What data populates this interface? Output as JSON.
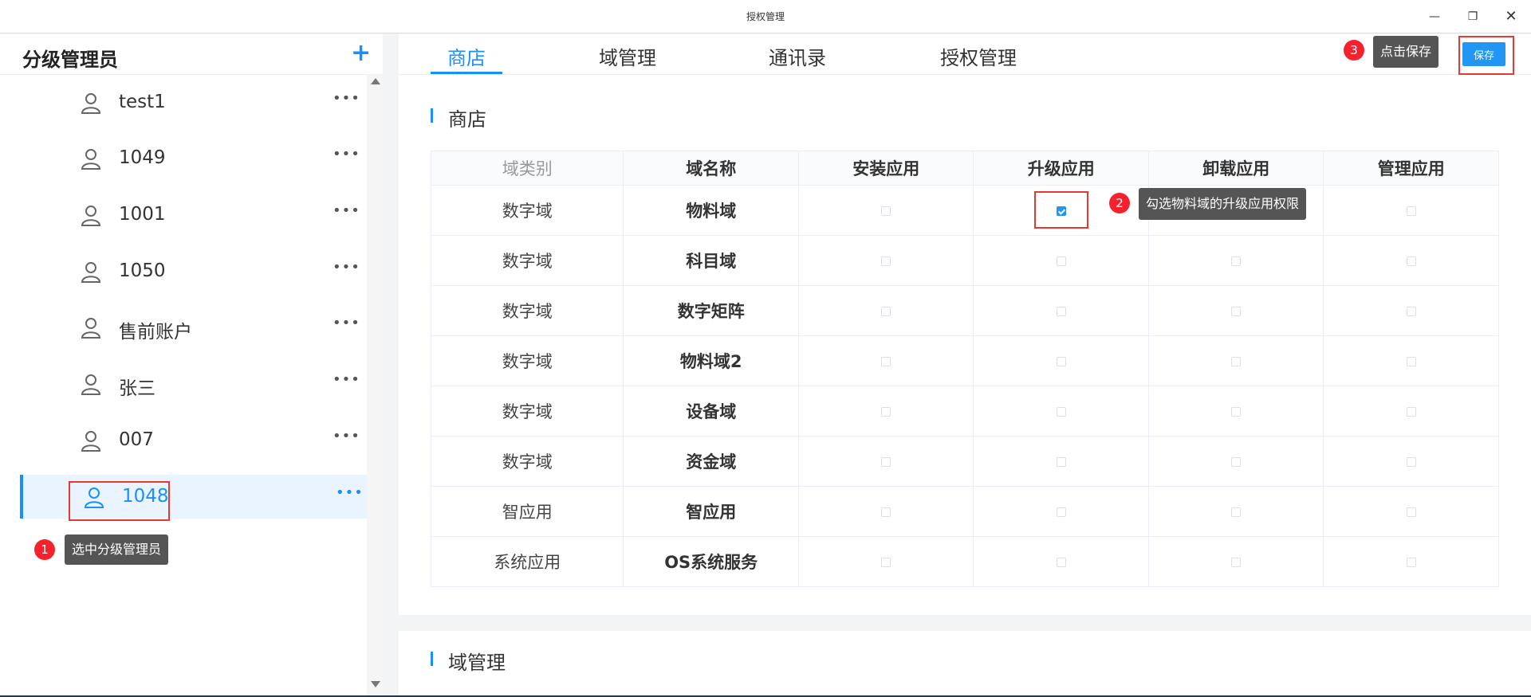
{
  "window": {
    "title": "授权管理",
    "min_glyph": "—",
    "max_glyph": "❐",
    "close_glyph": "✕"
  },
  "sidebar": {
    "title": "分级管理员",
    "add_glyph": "+",
    "more_glyph": "•••",
    "items": [
      {
        "label": "test1"
      },
      {
        "label": "1049"
      },
      {
        "label": "1001"
      },
      {
        "label": "1050"
      },
      {
        "label": "售前账户"
      },
      {
        "label": "张三"
      },
      {
        "label": "007"
      },
      {
        "label": "1048",
        "selected": true
      }
    ]
  },
  "tabs": [
    {
      "label": "商店",
      "active": true
    },
    {
      "label": "域管理"
    },
    {
      "label": "通讯录"
    },
    {
      "label": "授权管理"
    }
  ],
  "toolbar": {
    "save_label": "保存"
  },
  "sections": {
    "store": {
      "title": "商店",
      "columns": [
        "域类别",
        "域名称",
        "安装应用",
        "升级应用",
        "卸载应用",
        "管理应用"
      ],
      "rows": [
        {
          "category": "数字域",
          "name": "物料域",
          "install": false,
          "upgrade": true,
          "uninstall": false,
          "manage": false
        },
        {
          "category": "数字域",
          "name": "科目域",
          "install": false,
          "upgrade": false,
          "uninstall": false,
          "manage": false
        },
        {
          "category": "数字域",
          "name": "数字矩阵",
          "install": false,
          "upgrade": false,
          "uninstall": false,
          "manage": false
        },
        {
          "category": "数字域",
          "name": "物料域2",
          "install": false,
          "upgrade": false,
          "uninstall": false,
          "manage": false
        },
        {
          "category": "数字域",
          "name": "设备域",
          "install": false,
          "upgrade": false,
          "uninstall": false,
          "manage": false
        },
        {
          "category": "数字域",
          "name": "资金域",
          "install": false,
          "upgrade": false,
          "uninstall": false,
          "manage": false
        },
        {
          "category": "智应用",
          "name": "智应用",
          "install": false,
          "upgrade": false,
          "uninstall": false,
          "manage": false
        },
        {
          "category": "系统应用",
          "name": "OS系统服务",
          "install": false,
          "upgrade": false,
          "uninstall": false,
          "manage": false
        }
      ]
    },
    "domain": {
      "title": "域管理"
    }
  },
  "annotations": [
    {
      "step": "1",
      "text": "选中分级管理员"
    },
    {
      "step": "2",
      "text": "勾选物料域的升级应用权限"
    },
    {
      "step": "3",
      "text": "点击保存"
    }
  ],
  "colors": {
    "accent": "#1890ff",
    "highlight": "#e53935",
    "badge": "#f5222d",
    "tooltip": "#555555"
  }
}
